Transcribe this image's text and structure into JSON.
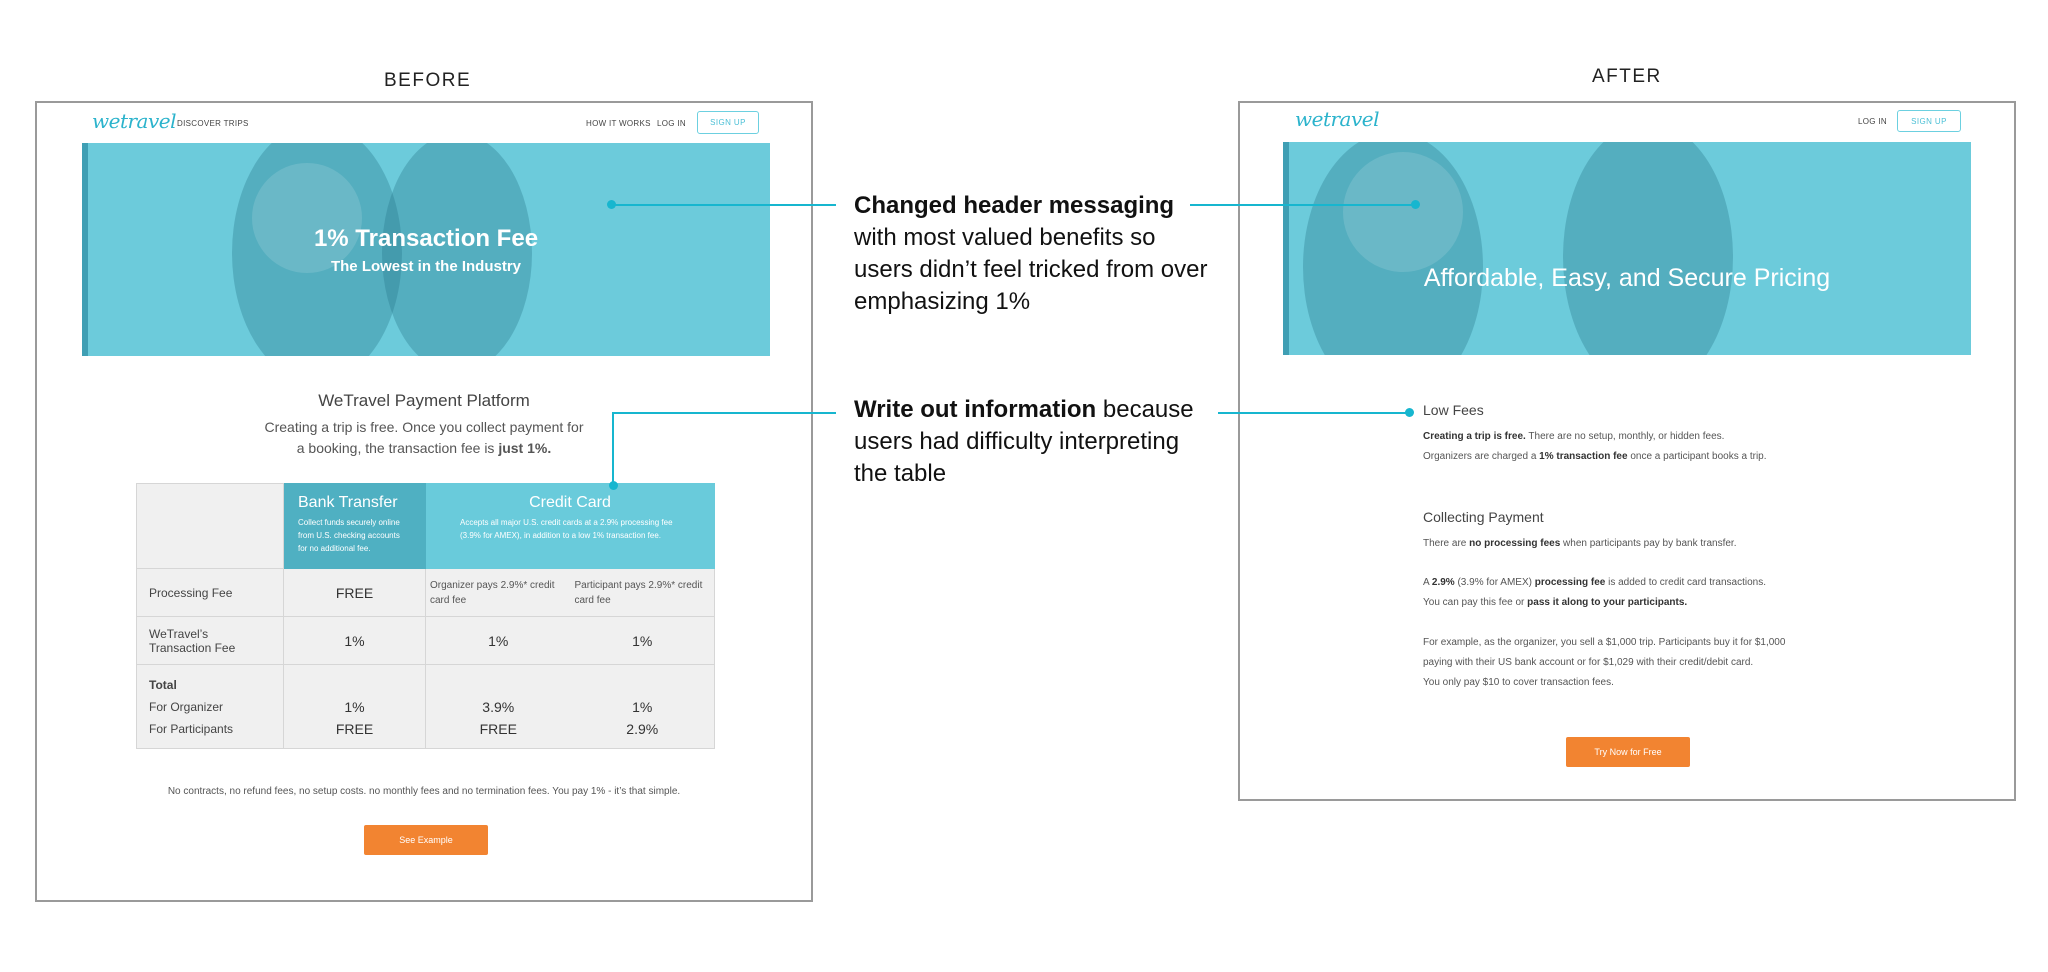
{
  "labels": {
    "before": "BEFORE",
    "after": "AFTER"
  },
  "before": {
    "logo": "wetravel",
    "nav": {
      "discover": "DISCOVER TRIPS",
      "how": "HOW IT WORKS",
      "login": "LOG IN",
      "signup": "SIGN UP"
    },
    "hero": {
      "title": "1% Transaction Fee",
      "subtitle": "The Lowest in the Industry"
    },
    "platform": {
      "title": "WeTravel Payment Platform",
      "line1": "Creating a trip is free. Once you collect payment for",
      "line2_pre": "a booking, the transaction fee is ",
      "line2_bold": "just 1%."
    },
    "table": {
      "bank_head": "Bank Transfer",
      "bank_sub": "Collect funds securely online from U.S. checking accounts for no additional fee.",
      "card_head": "Credit Card",
      "card_sub": "Accepts all major U.S. credit cards at a 2.9% processing fee (3.9% for AMEX), in addition to a low 1% transaction fee.",
      "rows": {
        "processing_label": "Processing Fee",
        "processing_bank": "FREE",
        "processing_org": "Organizer pays 2.9%* credit card fee",
        "processing_part": "Participant pays 2.9%* credit card fee",
        "wetravel_label": "WeTravel’s Transaction Fee",
        "wetravel_bank": "1%",
        "wetravel_org": "1%",
        "wetravel_part": "1%",
        "total_label": "Total",
        "for_org_label": "For Organizer",
        "for_part_label": "For Participants",
        "total_bank_org": "1%",
        "total_bank_part": "FREE",
        "total_card1_org": "3.9%",
        "total_card1_part": "FREE",
        "total_card2_org": "1%",
        "total_card2_part": "2.9%"
      }
    },
    "footer": "No contracts, no refund fees, no setup costs. no monthly fees and no termination fees. You pay 1% - it’s that simple.",
    "cta": "See Example"
  },
  "after": {
    "logo": "wetravel",
    "nav": {
      "login": "LOG IN",
      "signup": "SIGN UP"
    },
    "hero": {
      "title": "Affordable, Easy, and Secure Pricing"
    },
    "low_fees": {
      "title": "Low Fees",
      "l1_bold": "Creating a trip is free.",
      "l1_rest": " There are no setup, monthly, or hidden fees.",
      "l2_pre": "Organizers are charged a ",
      "l2_bold": "1% transaction fee",
      "l2_rest": " once a participant books a trip."
    },
    "collecting": {
      "title": "Collecting Payment",
      "p1_pre": "There are ",
      "p1_bold": "no processing fees",
      "p1_rest": " when participants pay by bank transfer.",
      "p2_pre": "A ",
      "p2_b1": "2.9%",
      "p2_mid": " (3.9% for AMEX) ",
      "p2_b2": "processing fee",
      "p2_rest": " is added to credit card transactions.",
      "p3_pre": "You can pay this fee or ",
      "p3_bold": "pass it along to your participants.",
      "ex1": "For example, as the organizer, you sell a $1,000 trip. Participants buy it for $1,000",
      "ex2": "paying with their US bank account or for $1,029 with their credit/debit card.",
      "ex3": "You only pay $10 to cover transaction fees."
    },
    "cta": "Try Now for Free"
  },
  "annotations": {
    "a1_bold": "Changed header messaging",
    "a1_l1": "with most valued benefits so",
    "a1_l2": "users didn’t feel tricked from over",
    "a1_l3": "emphasizing 1%",
    "a2_bold": "Write out information",
    "a2_rest": " because",
    "a2_l1": "users had difficulty interpreting",
    "a2_l2": "the table"
  }
}
